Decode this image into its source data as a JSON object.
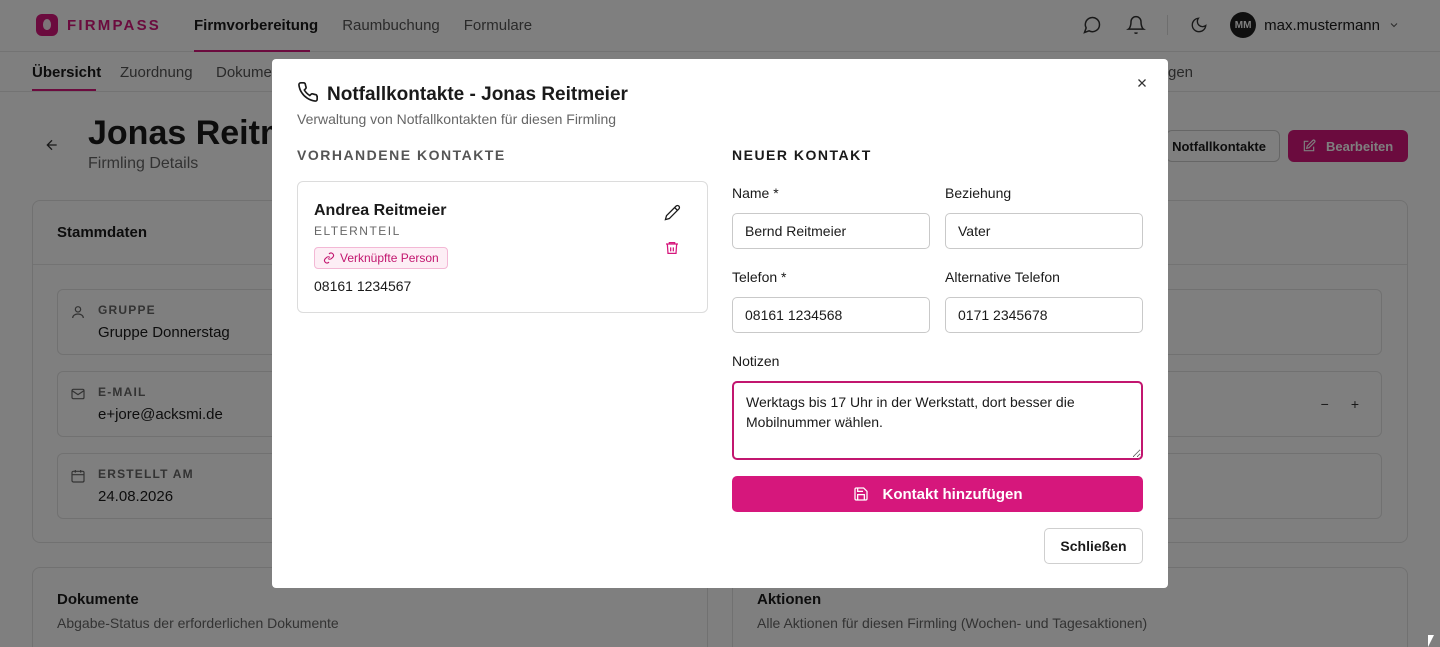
{
  "brand": {
    "name": "FIRMPASS",
    "accent": "#d6177c"
  },
  "mainnav": [
    "Firmvorbereitung",
    "Raumbuchung",
    "Formulare"
  ],
  "user": {
    "initials": "MM",
    "name": "max.mustermann"
  },
  "subnav": {
    "tabs": [
      "Übersicht",
      "Zuordnung",
      "Dokume"
    ],
    "right_fragment": "gen"
  },
  "page": {
    "title": "Jonas Reitm",
    "subtitle": "Firmling Details",
    "btn_notfall": "Notfallkontakte",
    "btn_edit": "Bearbeiten"
  },
  "stammdaten": {
    "title": "Stammdaten",
    "fields": [
      {
        "label": "GRUPPE",
        "value": "Gruppe Donnerstag",
        "icon": "user-icon"
      },
      {
        "label": "E-MAIL",
        "value": "e+jore@acksmi.de",
        "icon": "mail-icon"
      },
      {
        "label": "ERSTELLT AM",
        "value": "24.08.2026",
        "icon": "calendar-icon"
      }
    ],
    "stepper": {
      "minus": "−",
      "plus": "+"
    }
  },
  "documents": {
    "title": "Dokumente",
    "desc": "Abgabe-Status der erforderlichen Dokumente"
  },
  "actions": {
    "title": "Aktionen",
    "desc": "Alle Aktionen für diesen Firmling (Wochen- und Tagesaktionen)"
  },
  "modal": {
    "title": "Notfallkontakte - Jonas Reitmeier",
    "subtitle": "Verwaltung von Notfallkontakten für diesen Firmling",
    "existing_heading": "VORHANDENE KONTAKTE",
    "new_heading": "NEUER KONTAKT",
    "contact": {
      "name": "Andrea Reitmeier",
      "relation": "ELTERNTEIL",
      "badge": "Verknüpfte Person",
      "phone": "08161 1234567"
    },
    "form": {
      "name_label": "Name *",
      "name_value": "Bernd Reitmeier",
      "relation_label": "Beziehung",
      "relation_value": "Vater",
      "phone_label": "Telefon *",
      "phone_value": "08161 1234568",
      "alt_phone_label": "Alternative Telefon",
      "alt_phone_value": "0171 2345678",
      "notes_label": "Notizen",
      "notes_value": "Werktags bis 17 Uhr in der Werkstatt, dort besser die Mobilnummer wählen."
    },
    "add_button": "Kontakt hinzufügen",
    "close_button": "Schließen"
  }
}
